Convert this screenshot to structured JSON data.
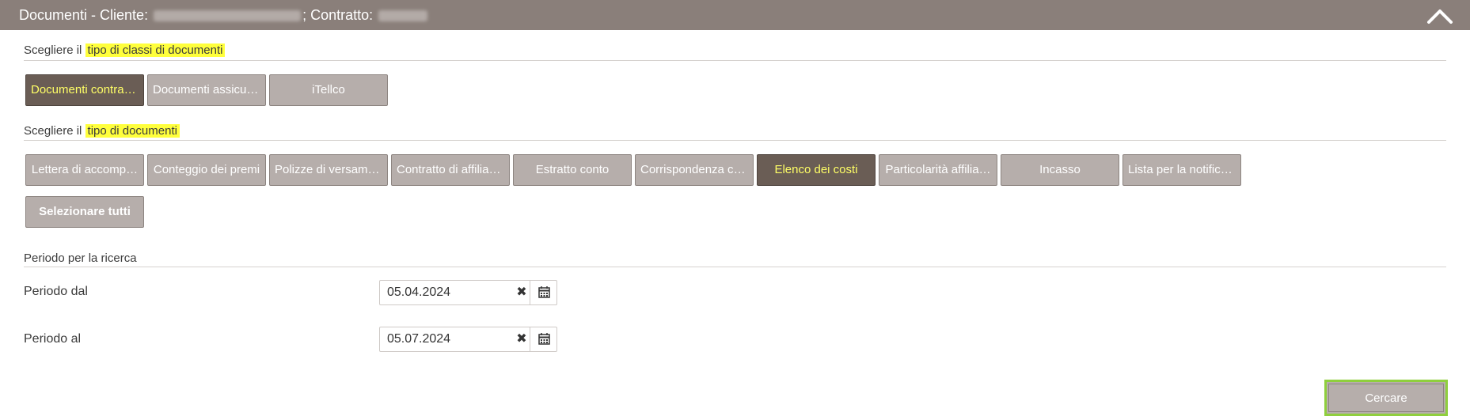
{
  "header": {
    "title_prefix": "Documenti - Cliente:",
    "contract_label": "; Contratto:"
  },
  "classes_section": {
    "label_prefix": "Scegliere il ",
    "label_highlight": "tipo di classi di documenti",
    "buttons": [
      {
        "label": "Documenti contrat…",
        "active": true
      },
      {
        "label": "Documenti assicur…",
        "active": false
      },
      {
        "label": "iTellco",
        "active": false
      }
    ]
  },
  "documents_section": {
    "label_prefix": "Scegliere il ",
    "label_highlight": "tipo di documenti",
    "buttons": [
      {
        "label": "Lettera di accomp…",
        "active": false
      },
      {
        "label": "Conteggio dei premi",
        "active": false
      },
      {
        "label": "Polizze di versame…",
        "active": false
      },
      {
        "label": "Contratto di affiliaz…",
        "active": false
      },
      {
        "label": "Estratto conto",
        "active": false
      },
      {
        "label": "Corrispondenza co…",
        "active": false
      },
      {
        "label": "Elenco dei costi",
        "active": true
      },
      {
        "label": "Particolarità affilia…",
        "active": false
      },
      {
        "label": "Incasso",
        "active": false
      },
      {
        "label": "Lista per la notifica…",
        "active": false
      }
    ],
    "select_all_label": "Selezionare tutti"
  },
  "period_section": {
    "label": "Periodo per la ricerca",
    "from_label": "Periodo dal",
    "from_value": "05.04.2024",
    "to_label": "Periodo al",
    "to_value": "05.07.2024"
  },
  "search_button_label": "Cercare",
  "icons": {
    "collapse": "chevron-up-icon",
    "clear": "close-icon",
    "calendar": "calendar-icon"
  },
  "colors": {
    "header": "#8a7f7a",
    "button": "#b6aeab",
    "button_active": "#6a5d55",
    "active_text": "#ffff66",
    "highlight": "#ffff3c",
    "focus_border": "#8fcf3d"
  }
}
